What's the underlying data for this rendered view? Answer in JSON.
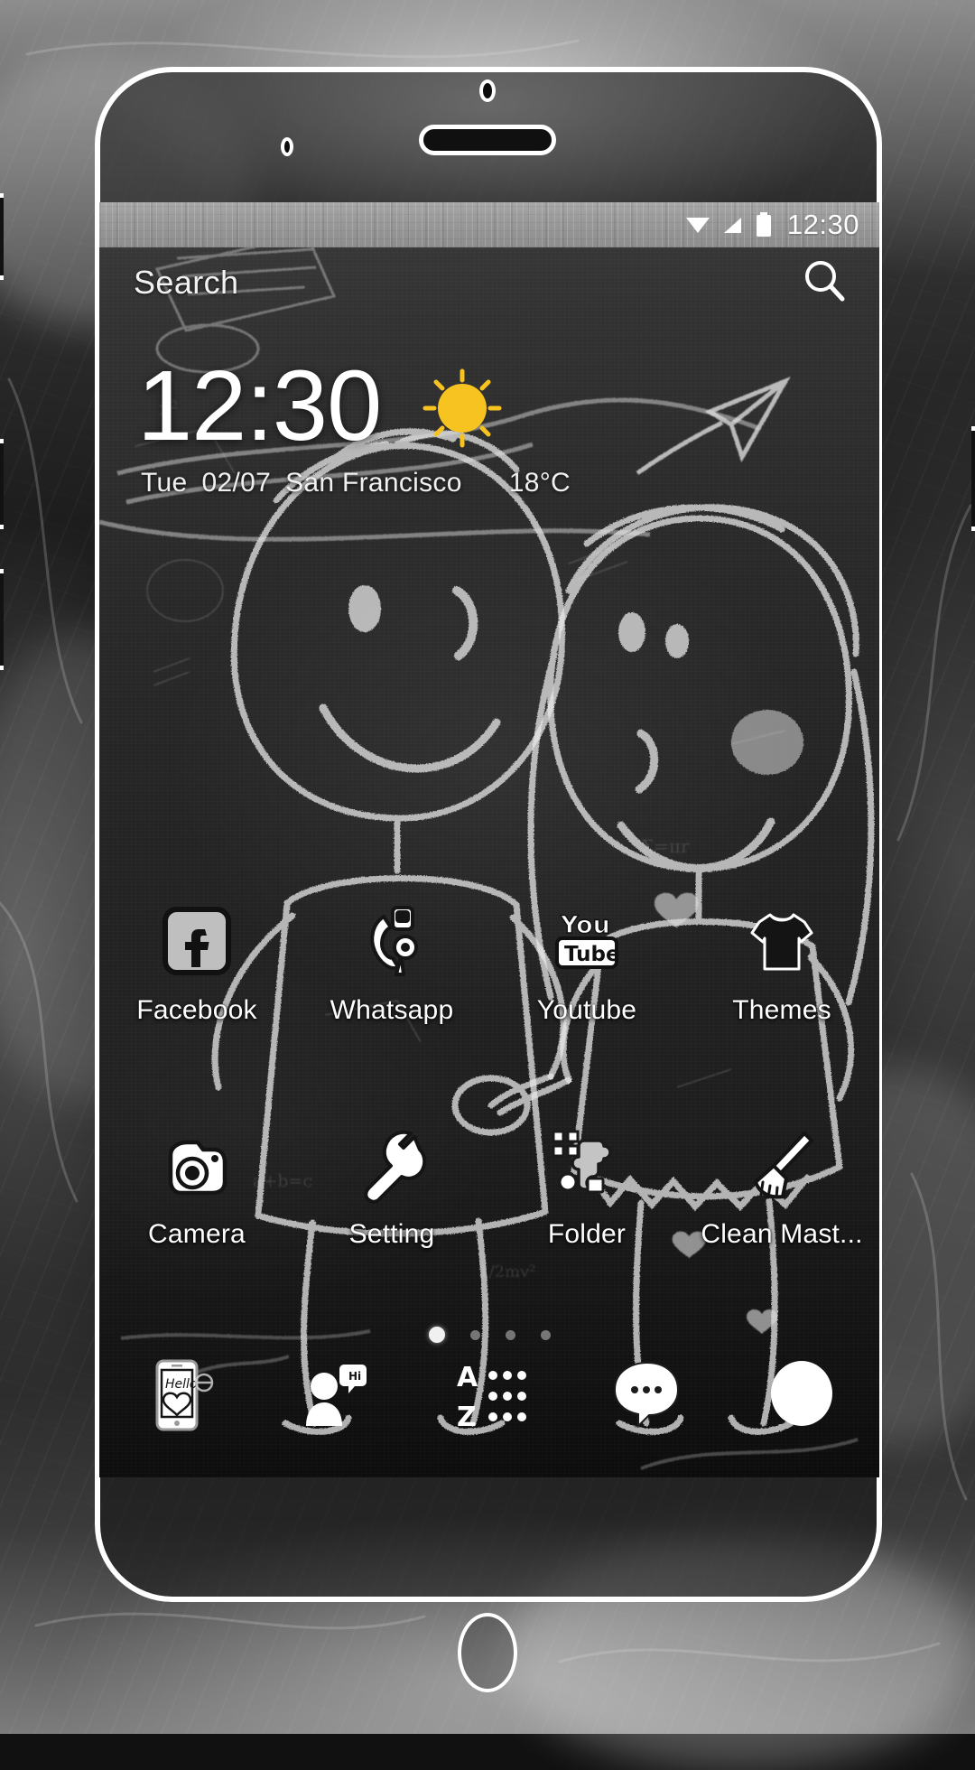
{
  "backdrop": {
    "description": "blurred dark chalkboard photo"
  },
  "device": {
    "frame_color": "#ffffff",
    "buttons": [
      {
        "name": "volume-up",
        "side": "left"
      },
      {
        "name": "volume-down",
        "side": "left"
      },
      {
        "name": "assist",
        "side": "left"
      },
      {
        "name": "power",
        "side": "right"
      }
    ],
    "home_button_label": "Home"
  },
  "status_bar": {
    "time": "12:30",
    "icons": [
      {
        "name": "wifi-icon",
        "glyph": "wifi"
      },
      {
        "name": "signal-icon",
        "glyph": "signal"
      },
      {
        "name": "battery-icon",
        "glyph": "battery"
      }
    ],
    "background_color": "#9a9a9a",
    "text_color": "#ffffff"
  },
  "search": {
    "placeholder": "Search",
    "icon": "search-icon"
  },
  "clock_widget": {
    "time": "12:30",
    "weather_icon": "sun-icon",
    "weather_icon_color": "#F6C321",
    "day": "Tue",
    "date": "02/07",
    "city": "San Francisco",
    "temperature": "18°C"
  },
  "home_screen": {
    "rows": [
      {
        "apps": [
          {
            "label": "Facebook",
            "icon": "facebook-icon"
          },
          {
            "label": "Whatsapp",
            "icon": "whatsapp-icon"
          },
          {
            "label": "Youtube",
            "icon": "youtube-icon"
          },
          {
            "label": "Themes",
            "icon": "tshirt-icon"
          }
        ]
      },
      {
        "apps": [
          {
            "label": "Camera",
            "icon": "camera-icon"
          },
          {
            "label": "Setting",
            "icon": "wrench-icon"
          },
          {
            "label": "Folder",
            "icon": "puzzle-icon"
          },
          {
            "label": "Clean Mast...",
            "icon": "broom-icon"
          }
        ]
      }
    ],
    "page_indicator": {
      "total": 4,
      "active": 1
    }
  },
  "dock": {
    "items": [
      {
        "label": "Phone",
        "icon": "phone-hello-icon"
      },
      {
        "label": "Contacts",
        "icon": "person-chat-icon"
      },
      {
        "label": "Apps",
        "icon": "app-drawer-az-icon"
      },
      {
        "label": "Messages",
        "icon": "speech-bubble-icon"
      },
      {
        "label": "Browser",
        "icon": "browser-oval-icon"
      }
    ]
  },
  "colors": {
    "accent_yellow": "#F6C321",
    "chalk_white": "#ffffff",
    "board_dark": "#242424",
    "status_gray": "#9a9a9a"
  }
}
